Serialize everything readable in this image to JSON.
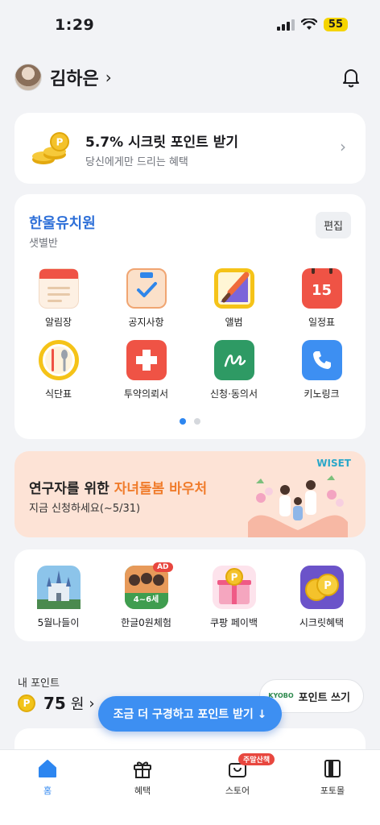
{
  "status_bar": {
    "time": "1:29",
    "battery": "55"
  },
  "profile": {
    "name": "김하은"
  },
  "promo": {
    "title": "5.7% 시크릿 포인트 받기",
    "subtitle": "당신에게만 드리는 혜택"
  },
  "school": {
    "name": "한울유치원",
    "class_name": "샛별반",
    "edit_label": "편집",
    "apps": [
      {
        "label": "알림장",
        "icon": "notebook-icon"
      },
      {
        "label": "공지사항",
        "icon": "clipboard-check-icon"
      },
      {
        "label": "앨범",
        "icon": "album-icon"
      },
      {
        "label": "일정표",
        "icon": "calendar-icon",
        "date": "15"
      },
      {
        "label": "식단표",
        "icon": "meal-icon"
      },
      {
        "label": "투약의뢰서",
        "icon": "medicine-icon"
      },
      {
        "label": "신청·동의서",
        "icon": "consent-icon"
      },
      {
        "label": "키노링크",
        "icon": "phone-icon"
      }
    ],
    "page_count": 2,
    "active_page": 1
  },
  "banner": {
    "title_prefix": "연구자를 위한 ",
    "title_highlight": "자녀돌봄 바우처",
    "subtitle": "지금 신청하세요(~5/31)",
    "logo": "WISET"
  },
  "events": [
    {
      "label": "5월나들이",
      "icon": "castle-icon"
    },
    {
      "label": "한글0원체험",
      "icon": "hangul-class-icon",
      "badge": "AD",
      "caption": "4~6세"
    },
    {
      "label": "쿠팡 페이백",
      "icon": "gift-coin-icon"
    },
    {
      "label": "시크릿혜택",
      "icon": "coins-icon"
    }
  ],
  "points": {
    "label": "내 포인트",
    "coin_symbol": "P",
    "value": "75",
    "unit": "원",
    "use_label": "포인트 쓰기",
    "kyobo_text": "KYOBO",
    "explore_label": "조금 더 구경하고 포인트 받기 ↓"
  },
  "tabs": [
    {
      "label": "홈",
      "active": true
    },
    {
      "label": "혜택",
      "active": false
    },
    {
      "label": "스토어",
      "active": false,
      "badge": "주말산책"
    },
    {
      "label": "포토몰",
      "active": false
    }
  ],
  "colors": {
    "accent": "#2d86f0",
    "school_name": "#2d6fd8",
    "banner_bg": "#fde3d6",
    "highlight": "#f07c2c",
    "badge_red": "#e8473f"
  }
}
